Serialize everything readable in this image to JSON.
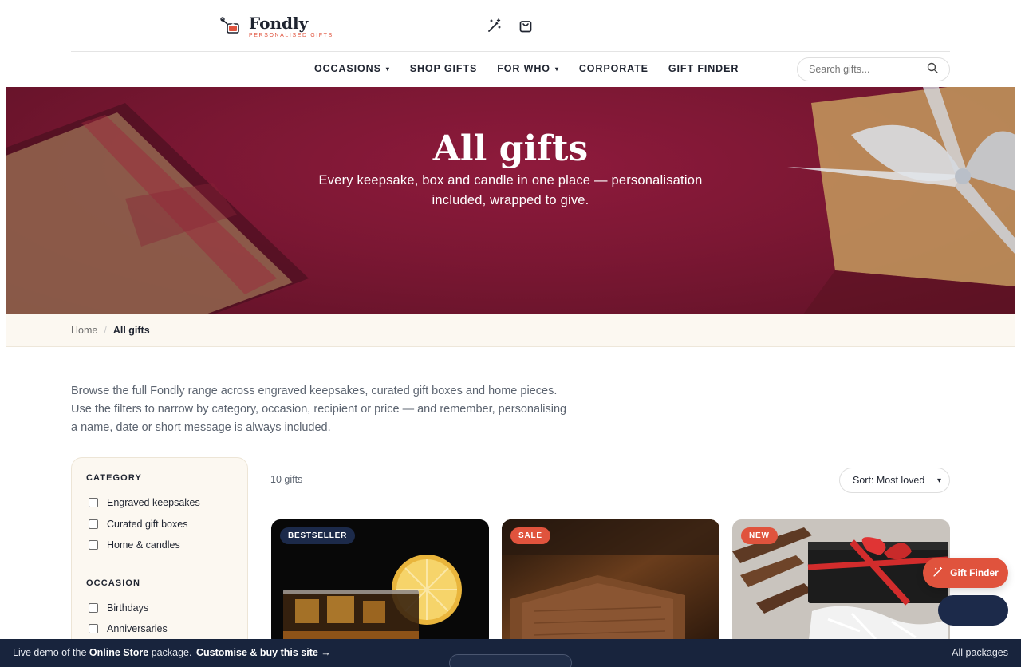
{
  "brand": {
    "name": "Fondly",
    "tagline": "PERSONALISED GIFTS",
    "accent": "#e0533d",
    "dark": "#1f2430"
  },
  "header_icons": [
    "magic-wand-icon",
    "shopping-bag-icon"
  ],
  "nav": {
    "items": [
      {
        "label": "OCCASIONS",
        "has_dropdown": true
      },
      {
        "label": "SHOP GIFTS",
        "has_dropdown": false
      },
      {
        "label": "FOR WHO",
        "has_dropdown": true
      },
      {
        "label": "CORPORATE",
        "has_dropdown": false
      },
      {
        "label": "GIFT FINDER",
        "has_dropdown": false
      }
    ],
    "chevron": "⌄"
  },
  "search": {
    "placeholder": "Search gifts..."
  },
  "hero": {
    "title": "All gifts",
    "subtitle": "Every keepsake, box and candle in one place — personalisation included, wrapped to give.",
    "background": "#7b1733"
  },
  "breadcrumb": {
    "home": "Home",
    "separator": "/",
    "current": "All gifts"
  },
  "intro": "Browse the full Fondly range across engraved keepsakes, curated gift boxes and home pieces. Use the filters to narrow by category, occasion, recipient or price — and remember, personalising a name, date or short message is always included.",
  "filters": {
    "category": {
      "heading": "CATEGORY",
      "options": [
        "Engraved keepsakes",
        "Curated gift boxes",
        "Home & candles"
      ]
    },
    "occasion": {
      "heading": "OCCASION",
      "options": [
        "Birthdays",
        "Anniversaries"
      ]
    }
  },
  "results": {
    "count": "10 gifts",
    "sort": {
      "selected": "Sort: Most loved"
    },
    "cards": [
      {
        "badge": "BESTSELLER",
        "badge_color": "#1c2a4a"
      },
      {
        "badge": "SALE",
        "badge_color": "#e0533d"
      },
      {
        "badge": "NEW",
        "badge_color": "#e0533d"
      }
    ]
  },
  "floating": {
    "gift_finder": "Gift Finder"
  },
  "demo_bar": {
    "prefix": "Live demo of the",
    "package": "Online Store",
    "suffix": "package.",
    "cta": "Customise & buy this site →",
    "right": "All packages"
  }
}
